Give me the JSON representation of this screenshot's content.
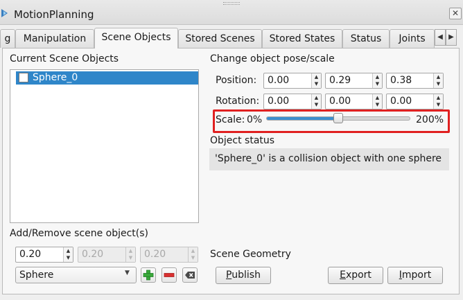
{
  "window": {
    "title": "MotionPlanning",
    "close": "✕"
  },
  "tabs": [
    {
      "label": "g"
    },
    {
      "label": "Manipulation"
    },
    {
      "label": "Scene Objects"
    },
    {
      "label": "Stored Scenes"
    },
    {
      "label": "Stored States"
    },
    {
      "label": "Status"
    },
    {
      "label": "Joints"
    }
  ],
  "tab_scroll": {
    "left": "◀",
    "right": "▶"
  },
  "scene_objects": {
    "heading": "Current Scene Objects",
    "items": [
      {
        "name": "Sphere_0",
        "checked": false,
        "selected": true
      }
    ]
  },
  "pose": {
    "heading": "Change object pose/scale",
    "position_label": "Position:",
    "position": [
      "0.00",
      "0.29",
      "0.38"
    ],
    "rotation_label": "Rotation:",
    "rotation": [
      "0.00",
      "0.00",
      "0.00"
    ],
    "scale_label": "Scale:",
    "scale_min": "0%",
    "scale_max": "200%",
    "scale_value_fraction": 0.5
  },
  "status": {
    "heading": "Object status",
    "text": "'Sphere_0' is a collision object with one sphere"
  },
  "add_remove": {
    "heading": "Add/Remove scene object(s)",
    "dims": [
      "0.20",
      "0.20",
      "0.20"
    ],
    "shape": "Sphere"
  },
  "geometry": {
    "heading": "Scene Geometry",
    "publish_mnemonic": "P",
    "publish_rest": "ublish",
    "export_mnemonic": "E",
    "export_rest": "xport",
    "import_mnemonic": "I",
    "import_rest": "mport"
  },
  "colors": {
    "selection": "#2f86c9",
    "highlight": "#e02020",
    "add": "#3aa83a",
    "remove": "#d93030"
  }
}
